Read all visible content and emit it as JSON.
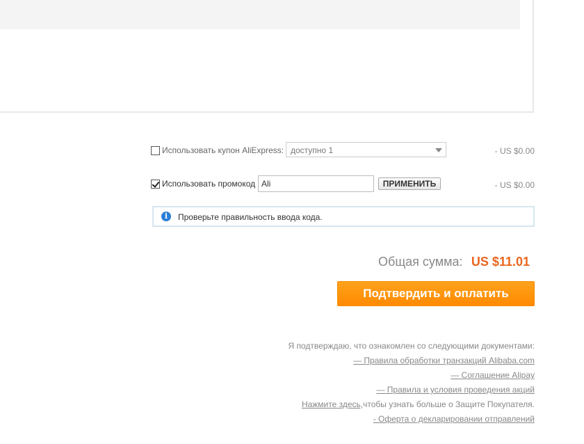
{
  "coupon": {
    "label": "Использовать купон AliExpress:",
    "select_value": "доступно 1",
    "amount": "- US $0.00",
    "checked": false
  },
  "promo": {
    "label": "Использовать промокод",
    "input_value": "Ali",
    "apply_label": "ПРИМЕНИТЬ",
    "amount": "- US $0.00",
    "checked": true
  },
  "notice": {
    "icon": "info-icon",
    "icon_glyph": "i",
    "text": "Проверьте правильность ввода кода."
  },
  "total": {
    "label": "Общая сумма:",
    "value": "US $11.01",
    "value_color": "#e9661f"
  },
  "pay_button": {
    "label": "Подтвердить и оплатить",
    "color": "#ff9600"
  },
  "documents": {
    "intro": "Я подтверждаю, что ознакомлен со следующими документами:",
    "links": [
      "— Правила обработки транзакций Alibaba.com",
      "— Соглашение Alipay",
      "— Правила и условия проведения акций"
    ],
    "protection_link": "Нажмите здесь,",
    "protection_text": "чтобы узнать больше о Защите Покупателя.",
    "declaration_link": "- Оферта о декларировании отправлений"
  }
}
